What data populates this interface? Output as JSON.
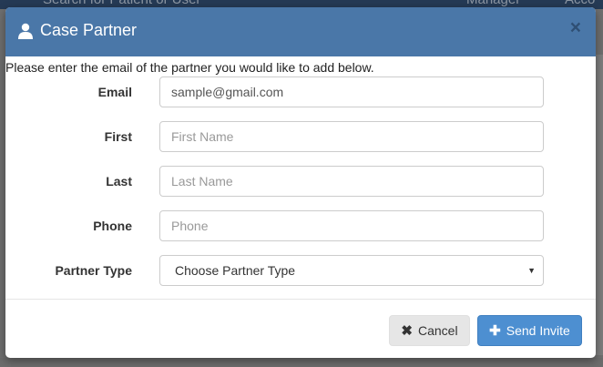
{
  "background": {
    "search_text": "Search for Patient or User",
    "manager_text": "Manager",
    "account_text": "Acco"
  },
  "modal": {
    "title": "Case Partner",
    "close_glyph": "×",
    "intro": "Please enter the email of the partner you would like to add below.",
    "fields": {
      "email": {
        "label": "Email",
        "value": "sample@gmail.com",
        "placeholder": ""
      },
      "first": {
        "label": "First",
        "value": "",
        "placeholder": "First Name"
      },
      "last": {
        "label": "Last",
        "value": "",
        "placeholder": "Last Name"
      },
      "phone": {
        "label": "Phone",
        "value": "",
        "placeholder": "Phone"
      },
      "partner_type": {
        "label": "Partner Type",
        "selected": "Choose Partner Type"
      }
    },
    "footer": {
      "cancel_label": "Cancel",
      "send_label": "Send Invite"
    }
  },
  "colors": {
    "header": "#4a77a8",
    "primary_button": "#4d8fd1",
    "default_button": "#e6e6e6"
  }
}
